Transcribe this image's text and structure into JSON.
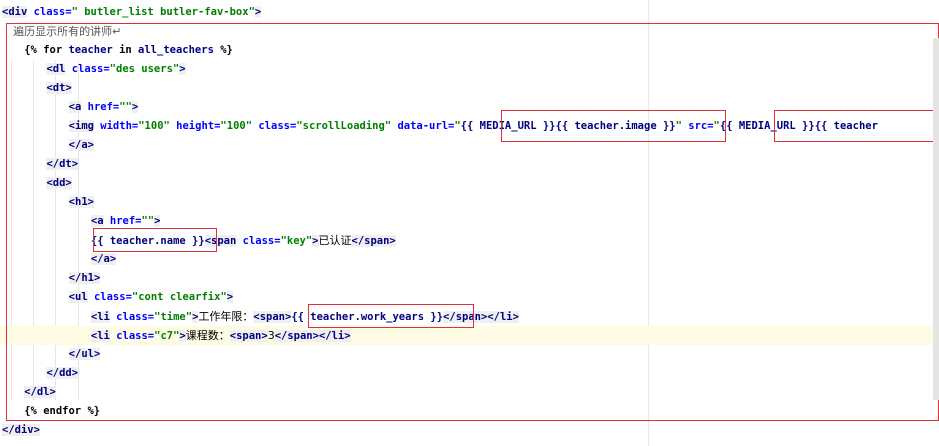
{
  "editor": {
    "lines": [
      {
        "indent": 0,
        "tokens": [
          {
            "t": "<div",
            "c": "tag"
          },
          {
            "t": " class=",
            "c": "attr"
          },
          {
            "t": "\" butler_list butler-fav-box\"",
            "c": "str"
          },
          {
            "t": ">",
            "c": "tag"
          }
        ]
      },
      {
        "indent": 1,
        "tokens": [
          {
            "t": "遍历显示所有的讲师",
            "c": "comment"
          },
          {
            "t": "↵",
            "c": "comment"
          }
        ]
      },
      {
        "indent": 2,
        "tokens": [
          {
            "t": "{% ",
            "c": "tpl"
          },
          {
            "t": "for",
            "c": "tpl"
          },
          {
            "t": " teacher ",
            "c": "var"
          },
          {
            "t": "in",
            "c": "tpl"
          },
          {
            "t": " all_teachers ",
            "c": "var"
          },
          {
            "t": "%}",
            "c": "tpl"
          }
        ]
      },
      {
        "indent": 4,
        "tokens": [
          {
            "t": "<dl",
            "c": "tag"
          },
          {
            "t": " class=",
            "c": "attr"
          },
          {
            "t": "\"des users\"",
            "c": "str"
          },
          {
            "t": ">",
            "c": "tag"
          }
        ]
      },
      {
        "indent": 4,
        "tokens": [
          {
            "t": "<dt>",
            "c": "tag"
          }
        ]
      },
      {
        "indent": 6,
        "tokens": [
          {
            "t": "<a",
            "c": "tag"
          },
          {
            "t": " href=",
            "c": "attr"
          },
          {
            "t": "\"\"",
            "c": "str"
          },
          {
            "t": ">",
            "c": "tag"
          }
        ]
      },
      {
        "indent": 6,
        "tokens": [
          {
            "t": "<img",
            "c": "tag"
          },
          {
            "t": " width=",
            "c": "attr"
          },
          {
            "t": "\"100\"",
            "c": "str"
          },
          {
            "t": " height=",
            "c": "attr"
          },
          {
            "t": "\"100\"",
            "c": "str"
          },
          {
            "t": " class=",
            "c": "attr"
          },
          {
            "t": "\"scrollLoading\"",
            "c": "str"
          },
          {
            "t": " data-url=",
            "c": "attr"
          },
          {
            "t": "\"",
            "c": "str"
          },
          {
            "t": "{{ MEDIA_URL }}{{ teacher.image }}",
            "c": "var"
          },
          {
            "t": "\"",
            "c": "str"
          },
          {
            "t": " src=",
            "c": "attr"
          },
          {
            "t": "\"",
            "c": "str"
          },
          {
            "t": "{{ MEDIA_URL }}{{ teacher",
            "c": "var"
          }
        ]
      },
      {
        "indent": 6,
        "tokens": [
          {
            "t": "</a>",
            "c": "tag"
          }
        ]
      },
      {
        "indent": 4,
        "tokens": [
          {
            "t": "</dt>",
            "c": "tag"
          }
        ]
      },
      {
        "indent": 4,
        "tokens": [
          {
            "t": "<dd>",
            "c": "tag"
          }
        ]
      },
      {
        "indent": 6,
        "tokens": [
          {
            "t": "<h1>",
            "c": "tag"
          }
        ]
      },
      {
        "indent": 8,
        "tokens": [
          {
            "t": "<a",
            "c": "tag"
          },
          {
            "t": " href=",
            "c": "attr"
          },
          {
            "t": "\"\"",
            "c": "str"
          },
          {
            "t": ">",
            "c": "tag"
          }
        ]
      },
      {
        "indent": 8,
        "tokens": [
          {
            "t": "{{ teacher.name }}",
            "c": "var"
          },
          {
            "t": "<span",
            "c": "tag"
          },
          {
            "t": " class=",
            "c": "attr"
          },
          {
            "t": "\"key\"",
            "c": "str"
          },
          {
            "t": ">",
            "c": "tag"
          },
          {
            "t": "已认证",
            "c": "txt"
          },
          {
            "t": "</span>",
            "c": "tag"
          }
        ]
      },
      {
        "indent": 8,
        "tokens": [
          {
            "t": "</a>",
            "c": "tag"
          }
        ]
      },
      {
        "indent": 6,
        "tokens": [
          {
            "t": "</h1>",
            "c": "tag"
          }
        ]
      },
      {
        "indent": 6,
        "tokens": [
          {
            "t": "<ul",
            "c": "tag"
          },
          {
            "t": " class=",
            "c": "attr"
          },
          {
            "t": "\"cont clearfix\"",
            "c": "str"
          },
          {
            "t": ">",
            "c": "tag"
          }
        ]
      },
      {
        "indent": 8,
        "tokens": [
          {
            "t": "<li",
            "c": "tag"
          },
          {
            "t": " class=",
            "c": "attr"
          },
          {
            "t": "\"time\"",
            "c": "str"
          },
          {
            "t": ">",
            "c": "tag"
          },
          {
            "t": "工作年限：",
            "c": "txt"
          },
          {
            "t": "<span>",
            "c": "tag"
          },
          {
            "t": "{{ teacher.work_years }}",
            "c": "var"
          },
          {
            "t": "</span>",
            "c": "tag"
          },
          {
            "t": "</li>",
            "c": "tag"
          }
        ]
      },
      {
        "indent": 8,
        "highlight": true,
        "tokens": [
          {
            "t": "<li",
            "c": "tag"
          },
          {
            "t": " class=",
            "c": "attr"
          },
          {
            "t": "\"c7\"",
            "c": "str"
          },
          {
            "t": ">",
            "c": "tag"
          },
          {
            "t": "课程数：",
            "c": "txt"
          },
          {
            "t": "<span>",
            "c": "tag"
          },
          {
            "t": "3",
            "c": "txt"
          },
          {
            "t": "</span>",
            "c": "tag"
          },
          {
            "t": "</li>",
            "c": "tag"
          }
        ]
      },
      {
        "indent": 6,
        "tokens": [
          {
            "t": "</ul>",
            "c": "tag"
          }
        ]
      },
      {
        "indent": 4,
        "tokens": [
          {
            "t": "</dd>",
            "c": "tag"
          }
        ]
      },
      {
        "indent": 2,
        "tokens": [
          {
            "t": "</dl>",
            "c": "tag"
          }
        ]
      },
      {
        "indent": 2,
        "tokens": [
          {
            "t": "{% ",
            "c": "tpl"
          },
          {
            "t": "endfor",
            "c": "tpl"
          },
          {
            "t": " %}",
            "c": "tpl"
          }
        ]
      },
      {
        "indent": 0,
        "tokens": [
          {
            "t": "</div>",
            "c": "tag"
          }
        ]
      }
    ]
  },
  "annotation": {
    "color": "#e0303c"
  }
}
